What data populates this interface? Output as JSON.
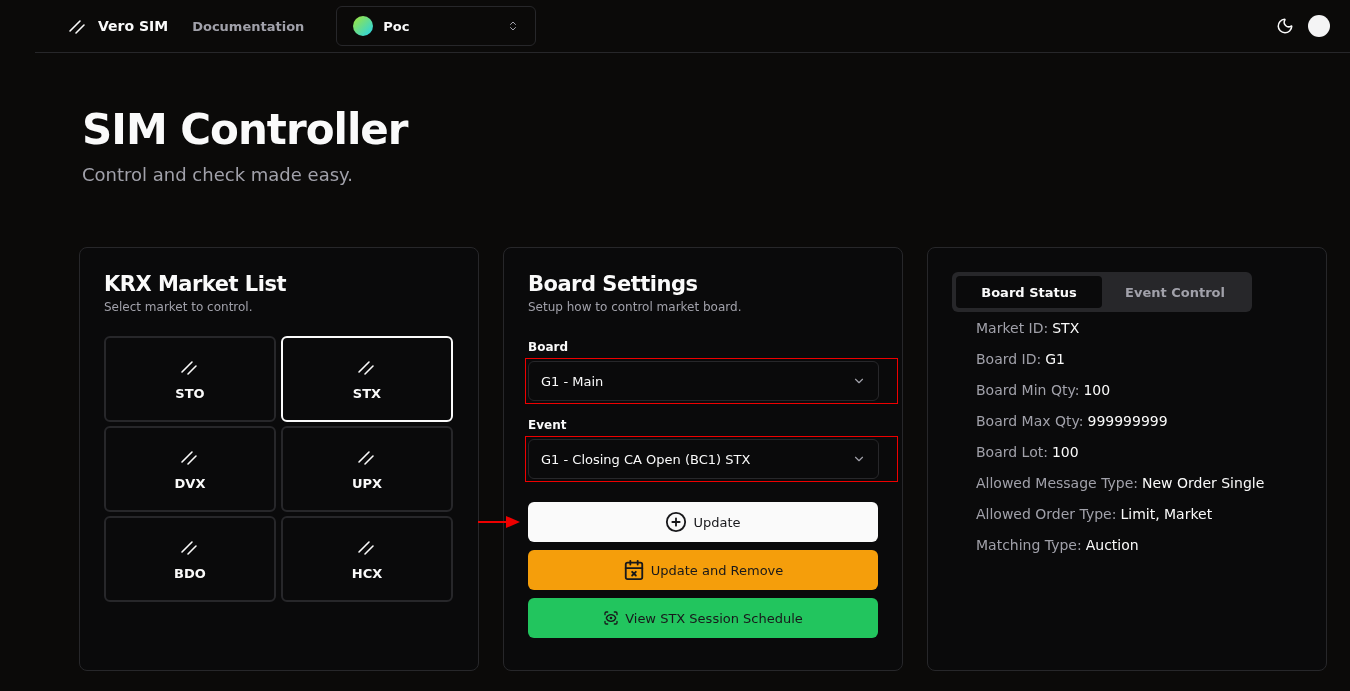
{
  "header": {
    "brand": "Vero SIM",
    "nav_link": "Documentation",
    "project_select": {
      "value": "Poc"
    }
  },
  "hero": {
    "title": "SIM Controller",
    "subtitle": "Control and check made easy."
  },
  "market_list": {
    "title": "KRX Market List",
    "subtitle": "Select market to control.",
    "markets": [
      {
        "label": "STO",
        "selected": false
      },
      {
        "label": "STX",
        "selected": true
      },
      {
        "label": "DVX",
        "selected": false
      },
      {
        "label": "UPX",
        "selected": false
      },
      {
        "label": "BDO",
        "selected": false
      },
      {
        "label": "HCX",
        "selected": false
      }
    ]
  },
  "board_settings": {
    "title": "Board Settings",
    "subtitle": "Setup how to control market board.",
    "fields": [
      {
        "label": "Board",
        "value": "G1 - Main",
        "highlighted": true
      },
      {
        "label": "Event",
        "value": "G1 - Closing CA Open (BC1) STX",
        "highlighted": true
      }
    ],
    "buttons": [
      {
        "kind": "primary",
        "label": "Update",
        "pointed": true
      },
      {
        "kind": "warning",
        "label": "Update and Remove",
        "pointed": false
      },
      {
        "kind": "success",
        "label": "View STX Session Schedule",
        "pointed": false
      }
    ]
  },
  "status_panel": {
    "tabs": [
      {
        "label": "Board Status",
        "selected": true
      },
      {
        "label": "Event Control",
        "selected": false
      }
    ],
    "rows": [
      {
        "label": "Market ID:",
        "value": "STX"
      },
      {
        "label": "Board ID:",
        "value": "G1"
      },
      {
        "label": "Board Min Qty:",
        "value": "100"
      },
      {
        "label": "Board Max Qty:",
        "value": "999999999"
      },
      {
        "label": "Board Lot:",
        "value": "100"
      },
      {
        "label": "Allowed Message Type:",
        "value": "New Order Single"
      },
      {
        "label": "Allowed Order Type:",
        "value": "Limit, Market"
      },
      {
        "label": "Matching Type:",
        "value": "Auction"
      }
    ]
  }
}
